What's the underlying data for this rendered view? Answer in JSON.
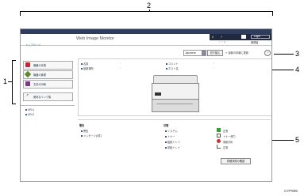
{
  "callouts": {
    "c1": "1",
    "c2": "2",
    "c3": "3",
    "c4": "4",
    "c5": "5"
  },
  "figure_id": "CYP908",
  "header": {
    "title": "Web Image Monitor",
    "breadcrumb": "トップページ",
    "top_icons": [
      "?",
      "Login"
    ],
    "lang_select": "Japanese",
    "go_button": "切り替え",
    "refresh_label": "最新の情報に更新",
    "help_icon": "?",
    "admin_label": "管理者"
  },
  "sidebar": {
    "items": [
      {
        "label": "機器の状態",
        "icon": "status-icon"
      },
      {
        "label": "機器の管理",
        "icon": "settings-icon"
      },
      {
        "label": "文書の印刷",
        "icon": "print-icon"
      },
      {
        "label": "便利なリンク集",
        "icon": "link-icon"
      }
    ],
    "links": [
      "URL1",
      "URL2"
    ]
  },
  "info": {
    "left": [
      {
        "label": "名前"
      },
      {
        "label": "設置場所"
      }
    ],
    "right": [
      {
        "label": "コメント"
      },
      {
        "label": "ホスト名"
      }
    ]
  },
  "status": {
    "left_title": "警告",
    "left_items": [
      "警告",
      "メッセージ(0件)"
    ],
    "right_title": "状態",
    "right_items": [
      {
        "label": "システム",
        "value": "正常",
        "color": "#2fa52f"
      },
      {
        "label": "トナー",
        "value": "トナー残り",
        "color": "#555555"
      },
      {
        "label": "給紙トレイ",
        "value": "用紙切れ",
        "color": "#d03030"
      },
      {
        "label": "排紙トレイ",
        "value": "正常",
        "color": "#555555"
      }
    ],
    "detail_button": "詳細状態の確認"
  }
}
